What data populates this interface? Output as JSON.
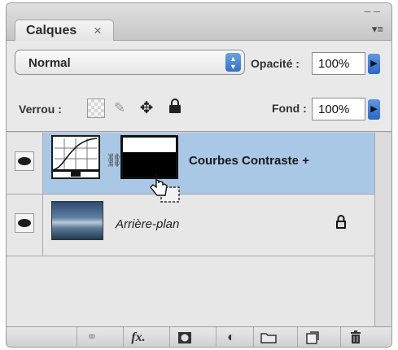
{
  "panel": {
    "tab_label": "Calques",
    "tab_close": "×",
    "collapse": "– –",
    "menu": "▾≡"
  },
  "toolbar": {
    "blend_mode": "Normal",
    "opacity_label": "Opacité :",
    "opacity_value": "100%",
    "lock_label": "Verrou :",
    "fill_label": "Fond :",
    "fill_value": "100%",
    "lock_icons": [
      "lock-transparency-icon",
      "brush-icon",
      "move-icon",
      "lock-icon"
    ]
  },
  "layers": [
    {
      "name": "Courbes Contraste +",
      "selected": true,
      "type": "adjustment-curves",
      "has_mask": true
    },
    {
      "name": "Arrière-plan",
      "selected": false,
      "type": "background",
      "locked": true
    }
  ],
  "bottom_icons": [
    "link-icon",
    "fx-icon",
    "add-mask-icon",
    "adjustment-layer-icon",
    "folder-icon",
    "new-layer-icon",
    "trash-icon"
  ],
  "bottom_glyphs": {
    "fx": "fx."
  },
  "colors": {
    "selected_row": "#a9c8e6",
    "accent_blue": "#2d6fd0"
  }
}
